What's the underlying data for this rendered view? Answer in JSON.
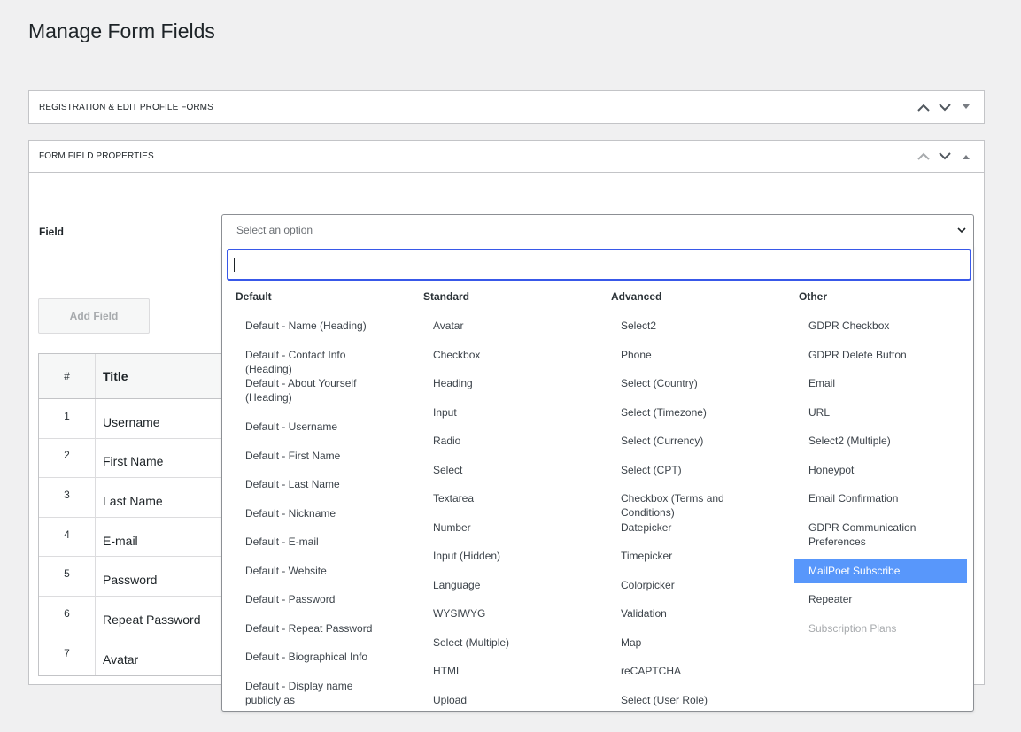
{
  "page": {
    "title": "Manage Form Fields"
  },
  "box1": {
    "title": "REGISTRATION & EDIT PROFILE FORMS"
  },
  "box2": {
    "title": "FORM FIELD PROPERTIES"
  },
  "form": {
    "field_label": "Field",
    "select_placeholder": "Select an option",
    "add_button": "Add Field"
  },
  "table": {
    "headers": [
      "#",
      "Title"
    ],
    "rows": [
      {
        "num": "1",
        "title": "Username"
      },
      {
        "num": "2",
        "title": "First Name"
      },
      {
        "num": "3",
        "title": "Last Name"
      },
      {
        "num": "4",
        "title": "E-mail"
      },
      {
        "num": "5",
        "title": "Password"
      },
      {
        "num": "6",
        "title": "Repeat Password"
      },
      {
        "num": "7",
        "title": "Avatar"
      }
    ]
  },
  "dropdown": {
    "search_value": "",
    "groups": [
      {
        "label": "Default",
        "options": [
          "Default - Name (Heading)",
          "Default - Contact Info (Heading)",
          "Default - About Yourself (Heading)",
          "Default - Username",
          "Default - First Name",
          "Default - Last Name",
          "Default - Nickname",
          "Default - E-mail",
          "Default - Website",
          "Default - Password",
          "Default - Repeat Password",
          "Default - Biographical Info",
          "Default - Display name publicly as"
        ]
      },
      {
        "label": "Standard",
        "options": [
          "Avatar",
          "Checkbox",
          "Heading",
          "Input",
          "Radio",
          "Select",
          "Textarea",
          "Number",
          "Input (Hidden)",
          "Language",
          "WYSIWYG",
          "Select (Multiple)",
          "HTML",
          "Upload"
        ]
      },
      {
        "label": "Advanced",
        "options": [
          "Select2",
          "Phone",
          "Select (Country)",
          "Select (Timezone)",
          "Select (Currency)",
          "Select (CPT)",
          "Checkbox (Terms and Conditions)",
          "Datepicker",
          "Timepicker",
          "Colorpicker",
          "Validation",
          "Map",
          "reCAPTCHA",
          "Select (User Role)"
        ]
      },
      {
        "label": "Other",
        "options": [
          "GDPR Checkbox",
          "GDPR Delete Button",
          "Email",
          "URL",
          "Select2 (Multiple)",
          "Honeypot",
          "Email Confirmation",
          "GDPR Communication Preferences",
          "MailPoet Subscribe",
          "Repeater",
          "Subscription Plans"
        ],
        "highlighted": "MailPoet Subscribe",
        "disabled": [
          "Subscription Plans"
        ]
      }
    ]
  },
  "colors": {
    "highlight": "#5897fb",
    "focus": "#3858e9"
  }
}
